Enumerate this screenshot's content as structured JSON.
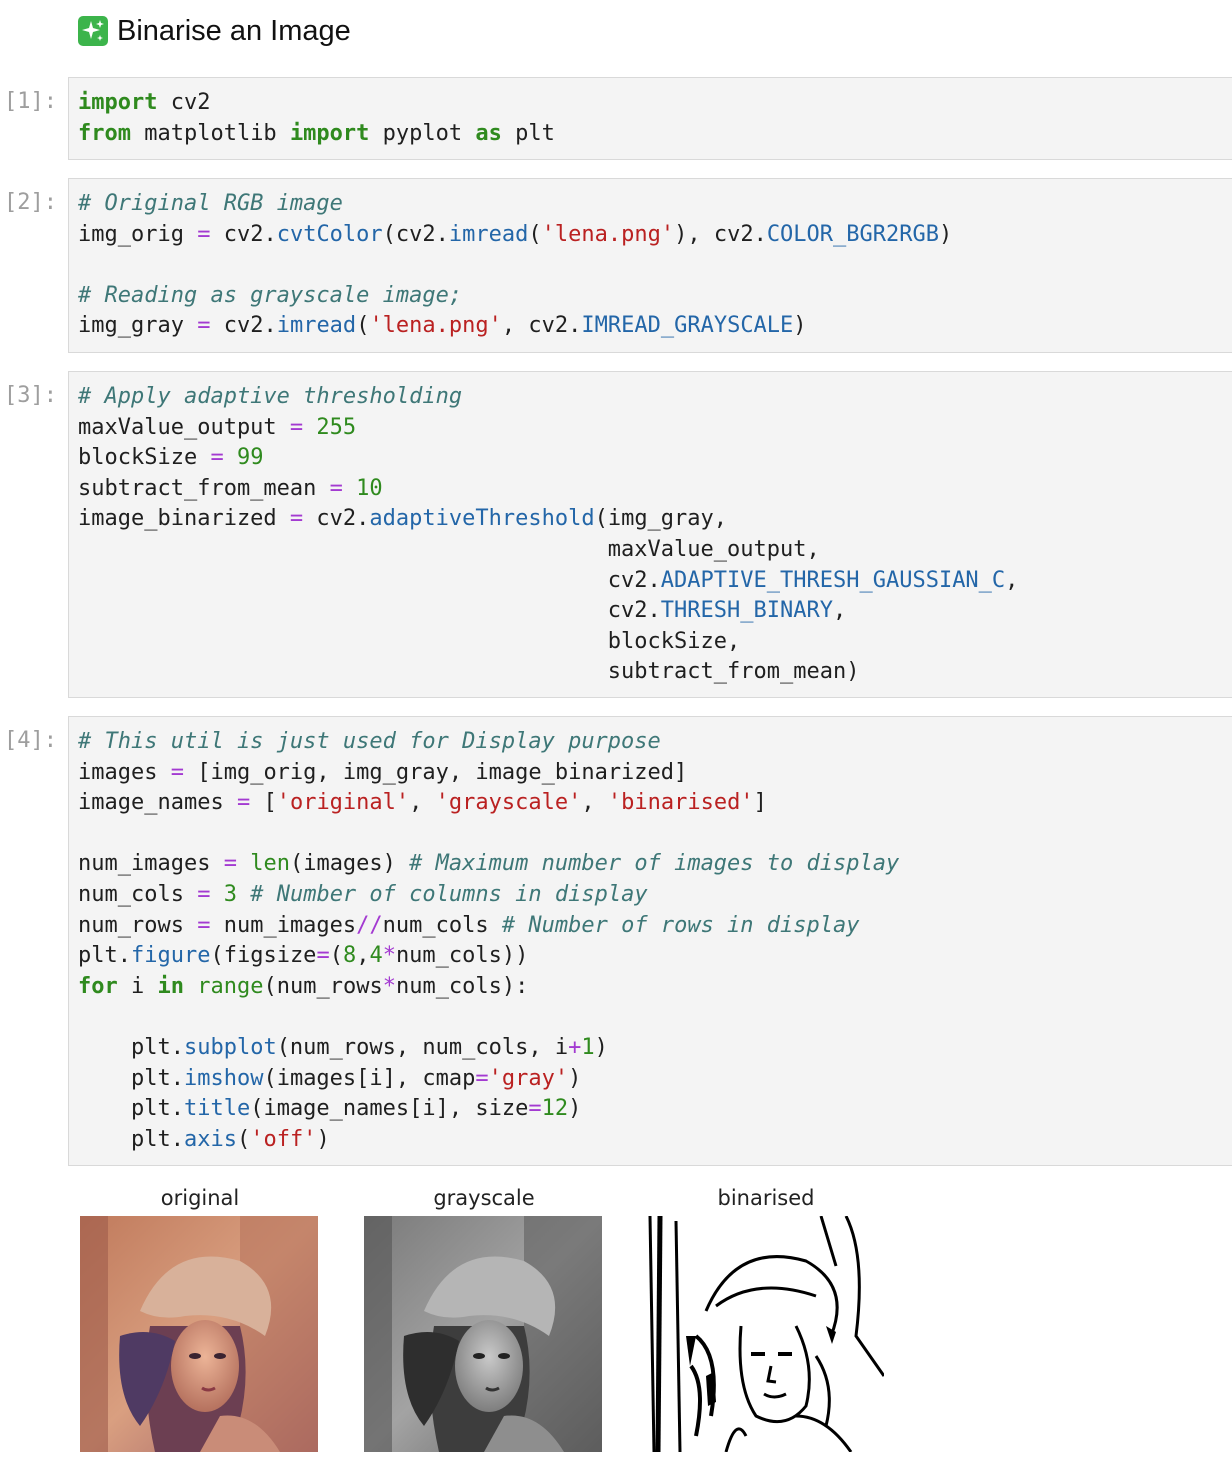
{
  "heading": {
    "icon": "sparkles-icon",
    "text": "Binarise an Image"
  },
  "cells": [
    {
      "prompt": "[1]:",
      "lines": [
        [
          [
            "kw",
            "import"
          ],
          [
            "t",
            " cv2"
          ]
        ],
        [
          [
            "kw",
            "from"
          ],
          [
            "t",
            " matplotlib "
          ],
          [
            "kw",
            "import"
          ],
          [
            "t",
            " pyplot "
          ],
          [
            "kw",
            "as"
          ],
          [
            "t",
            " plt"
          ]
        ]
      ]
    },
    {
      "prompt": "[2]:",
      "lines": [
        [
          [
            "cm",
            "# Original RGB image"
          ]
        ],
        [
          [
            "t",
            "img_orig "
          ],
          [
            "op",
            "="
          ],
          [
            "t",
            " cv2."
          ],
          [
            "fn",
            "cvtColor"
          ],
          [
            "t",
            "(cv2."
          ],
          [
            "fn",
            "imread"
          ],
          [
            "t",
            "("
          ],
          [
            "st",
            "'lena.png'"
          ],
          [
            "t",
            "), cv2."
          ],
          [
            "at",
            "COLOR_BGR2RGB"
          ],
          [
            "t",
            ")"
          ]
        ],
        [],
        [
          [
            "cm",
            "# Reading as grayscale image;"
          ]
        ],
        [
          [
            "t",
            "img_gray "
          ],
          [
            "op",
            "="
          ],
          [
            "t",
            " cv2."
          ],
          [
            "fn",
            "imread"
          ],
          [
            "t",
            "("
          ],
          [
            "st",
            "'lena.png'"
          ],
          [
            "t",
            ", cv2."
          ],
          [
            "at",
            "IMREAD_GRAYSCALE"
          ],
          [
            "t",
            ")"
          ]
        ]
      ]
    },
    {
      "prompt": "[3]:",
      "lines": [
        [
          [
            "cm",
            "# Apply adaptive thresholding"
          ]
        ],
        [
          [
            "t",
            "maxValue_output "
          ],
          [
            "op",
            "="
          ],
          [
            "t",
            " "
          ],
          [
            "nm",
            "255"
          ]
        ],
        [
          [
            "t",
            "blockSize "
          ],
          [
            "op",
            "="
          ],
          [
            "t",
            " "
          ],
          [
            "nm",
            "99"
          ]
        ],
        [
          [
            "t",
            "subtract_from_mean "
          ],
          [
            "op",
            "="
          ],
          [
            "t",
            " "
          ],
          [
            "nm",
            "10"
          ]
        ],
        [
          [
            "t",
            "image_binarized "
          ],
          [
            "op",
            "="
          ],
          [
            "t",
            " cv2."
          ],
          [
            "fn",
            "adaptiveThreshold"
          ],
          [
            "t",
            "(img_gray,"
          ]
        ],
        [
          [
            "t",
            "                                        maxValue_output,"
          ]
        ],
        [
          [
            "t",
            "                                        cv2."
          ],
          [
            "at",
            "ADAPTIVE_THRESH_GAUSSIAN_C"
          ],
          [
            "t",
            ","
          ]
        ],
        [
          [
            "t",
            "                                        cv2."
          ],
          [
            "at",
            "THRESH_BINARY"
          ],
          [
            "t",
            ","
          ]
        ],
        [
          [
            "t",
            "                                        blockSize,"
          ]
        ],
        [
          [
            "t",
            "                                        subtract_from_mean)"
          ]
        ]
      ]
    },
    {
      "prompt": "[4]:",
      "lines": [
        [
          [
            "cm",
            "# This util is just used for Display purpose"
          ]
        ],
        [
          [
            "t",
            "images "
          ],
          [
            "op",
            "="
          ],
          [
            "t",
            " [img_orig, img_gray, image_binarized]"
          ]
        ],
        [
          [
            "t",
            "image_names "
          ],
          [
            "op",
            "="
          ],
          [
            "t",
            " ["
          ],
          [
            "st",
            "'original'"
          ],
          [
            "t",
            ", "
          ],
          [
            "st",
            "'grayscale'"
          ],
          [
            "t",
            ", "
          ],
          [
            "st",
            "'binarised'"
          ],
          [
            "t",
            "]"
          ]
        ],
        [],
        [
          [
            "t",
            "num_images "
          ],
          [
            "op",
            "="
          ],
          [
            "t",
            " "
          ],
          [
            "nm",
            "len"
          ],
          [
            "t",
            "(images) "
          ],
          [
            "cm",
            "# Maximum number of images to display"
          ]
        ],
        [
          [
            "t",
            "num_cols "
          ],
          [
            "op",
            "="
          ],
          [
            "t",
            " "
          ],
          [
            "nm",
            "3"
          ],
          [
            "t",
            " "
          ],
          [
            "cm",
            "# Number of columns in display"
          ]
        ],
        [
          [
            "t",
            "num_rows "
          ],
          [
            "op",
            "="
          ],
          [
            "t",
            " num_images"
          ],
          [
            "op",
            "//"
          ],
          [
            "t",
            "num_cols "
          ],
          [
            "cm",
            "# Number of rows in display"
          ]
        ],
        [
          [
            "t",
            "plt."
          ],
          [
            "fn",
            "figure"
          ],
          [
            "t",
            "(figsize"
          ],
          [
            "op",
            "="
          ],
          [
            "t",
            "("
          ],
          [
            "nm",
            "8"
          ],
          [
            "t",
            ","
          ],
          [
            "nm",
            "4"
          ],
          [
            "op",
            "*"
          ],
          [
            "t",
            "num_cols))"
          ]
        ],
        [
          [
            "kw",
            "for"
          ],
          [
            "t",
            " i "
          ],
          [
            "kw",
            "in"
          ],
          [
            "t",
            " "
          ],
          [
            "nm",
            "range"
          ],
          [
            "t",
            "(num_rows"
          ],
          [
            "op",
            "*"
          ],
          [
            "t",
            "num_cols):"
          ]
        ],
        [],
        [
          [
            "t",
            "    plt."
          ],
          [
            "fn",
            "subplot"
          ],
          [
            "t",
            "(num_rows, num_cols, i"
          ],
          [
            "op",
            "+"
          ],
          [
            "nm",
            "1"
          ],
          [
            "t",
            ")"
          ]
        ],
        [
          [
            "t",
            "    plt."
          ],
          [
            "fn",
            "imshow"
          ],
          [
            "t",
            "(images[i], cmap"
          ],
          [
            "op",
            "="
          ],
          [
            "st",
            "'gray'"
          ],
          [
            "t",
            ")"
          ]
        ],
        [
          [
            "t",
            "    plt."
          ],
          [
            "fn",
            "title"
          ],
          [
            "t",
            "(image_names[i], size"
          ],
          [
            "op",
            "="
          ],
          [
            "nm",
            "12"
          ],
          [
            "t",
            ")"
          ]
        ],
        [
          [
            "t",
            "    plt."
          ],
          [
            "fn",
            "axis"
          ],
          [
            "t",
            "("
          ],
          [
            "st",
            "'off'"
          ],
          [
            "t",
            ")"
          ]
        ]
      ]
    }
  ],
  "output": [
    {
      "title": "original"
    },
    {
      "title": "grayscale"
    },
    {
      "title": "binarised"
    }
  ]
}
